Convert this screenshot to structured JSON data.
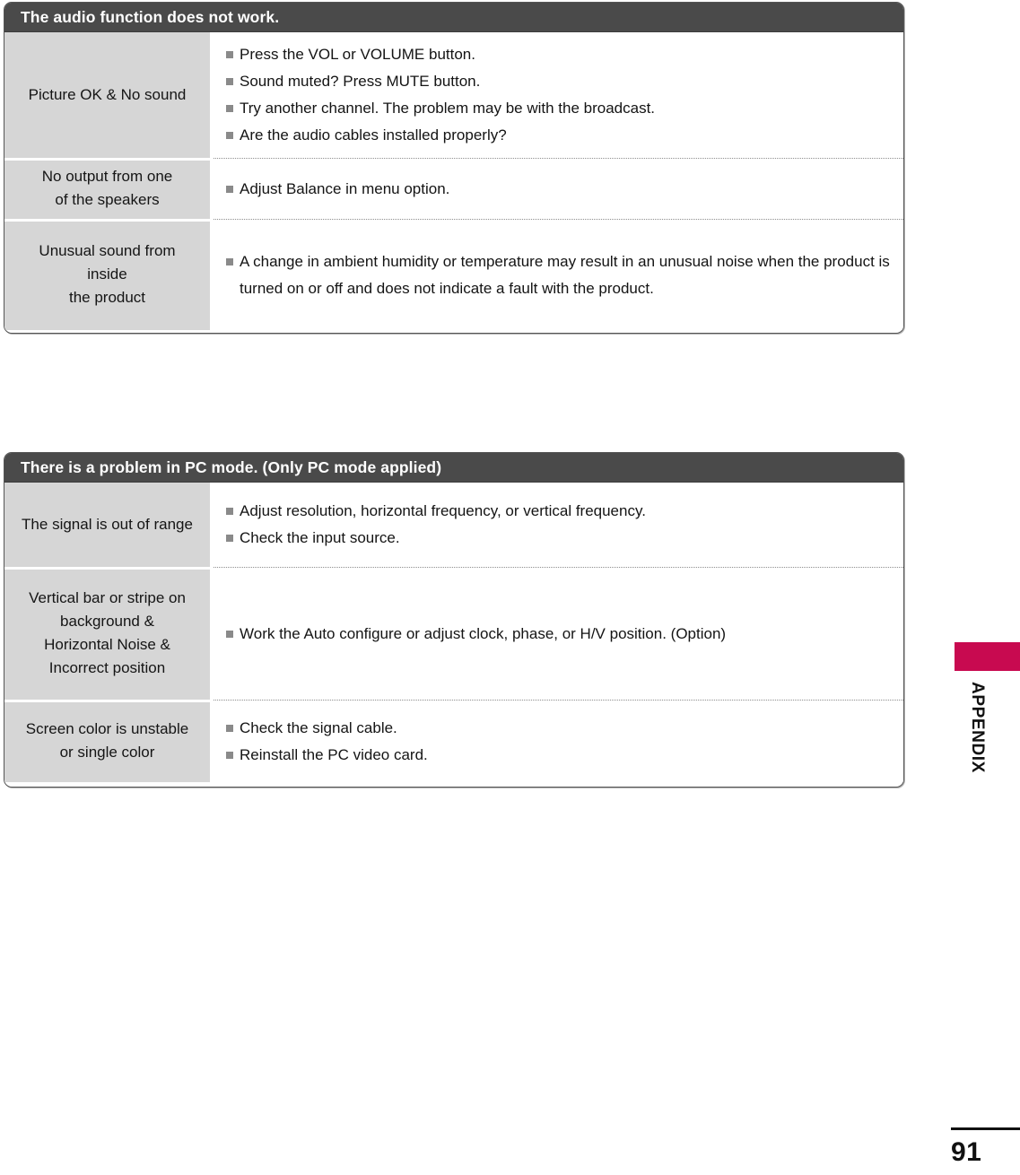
{
  "page": {
    "number": "91",
    "section_label": "APPENDIX",
    "accent_color": "#c80a50",
    "header_bar_color": "#4a4a4a",
    "cause_cell_color": "#d6d6d6"
  },
  "tables": [
    {
      "id": "audio",
      "header": "The audio function does not work.",
      "rows": [
        {
          "cause_lines": [
            "Picture OK & No sound"
          ],
          "remedies": [
            "Press the VOL or VOLUME button.",
            "Sound muted? Press MUTE button.",
            "Try another channel. The problem may be with the broadcast.",
            "Are the audio cables installed properly?"
          ]
        },
        {
          "cause_lines": [
            "No output from one",
            "of the speakers"
          ],
          "remedies": [
            "Adjust Balance in menu option."
          ]
        },
        {
          "cause_lines": [
            "Unusual sound from",
            "inside",
            "the product"
          ],
          "remedies": [
            "A change in ambient humidity or temperature may result in an unusual noise when the product is turned on or off and does not indicate a fault with the product."
          ]
        }
      ]
    },
    {
      "id": "pcmode",
      "header": "There is a problem in PC mode. (Only PC mode applied)",
      "rows": [
        {
          "cause_lines": [
            "The signal is out of range"
          ],
          "remedies": [
            "Adjust resolution, horizontal frequency, or vertical frequency.",
            "Check the input source."
          ]
        },
        {
          "cause_lines": [
            "Vertical bar or stripe on",
            "background &",
            "Horizontal Noise &",
            "Incorrect position"
          ],
          "remedies": [
            "Work the Auto configure or adjust clock, phase, or H/V position. (Option)"
          ]
        },
        {
          "cause_lines": [
            "Screen color is unstable",
            "or single color"
          ],
          "remedies": [
            "Check the signal cable.",
            "Reinstall the PC video card."
          ]
        }
      ]
    }
  ]
}
